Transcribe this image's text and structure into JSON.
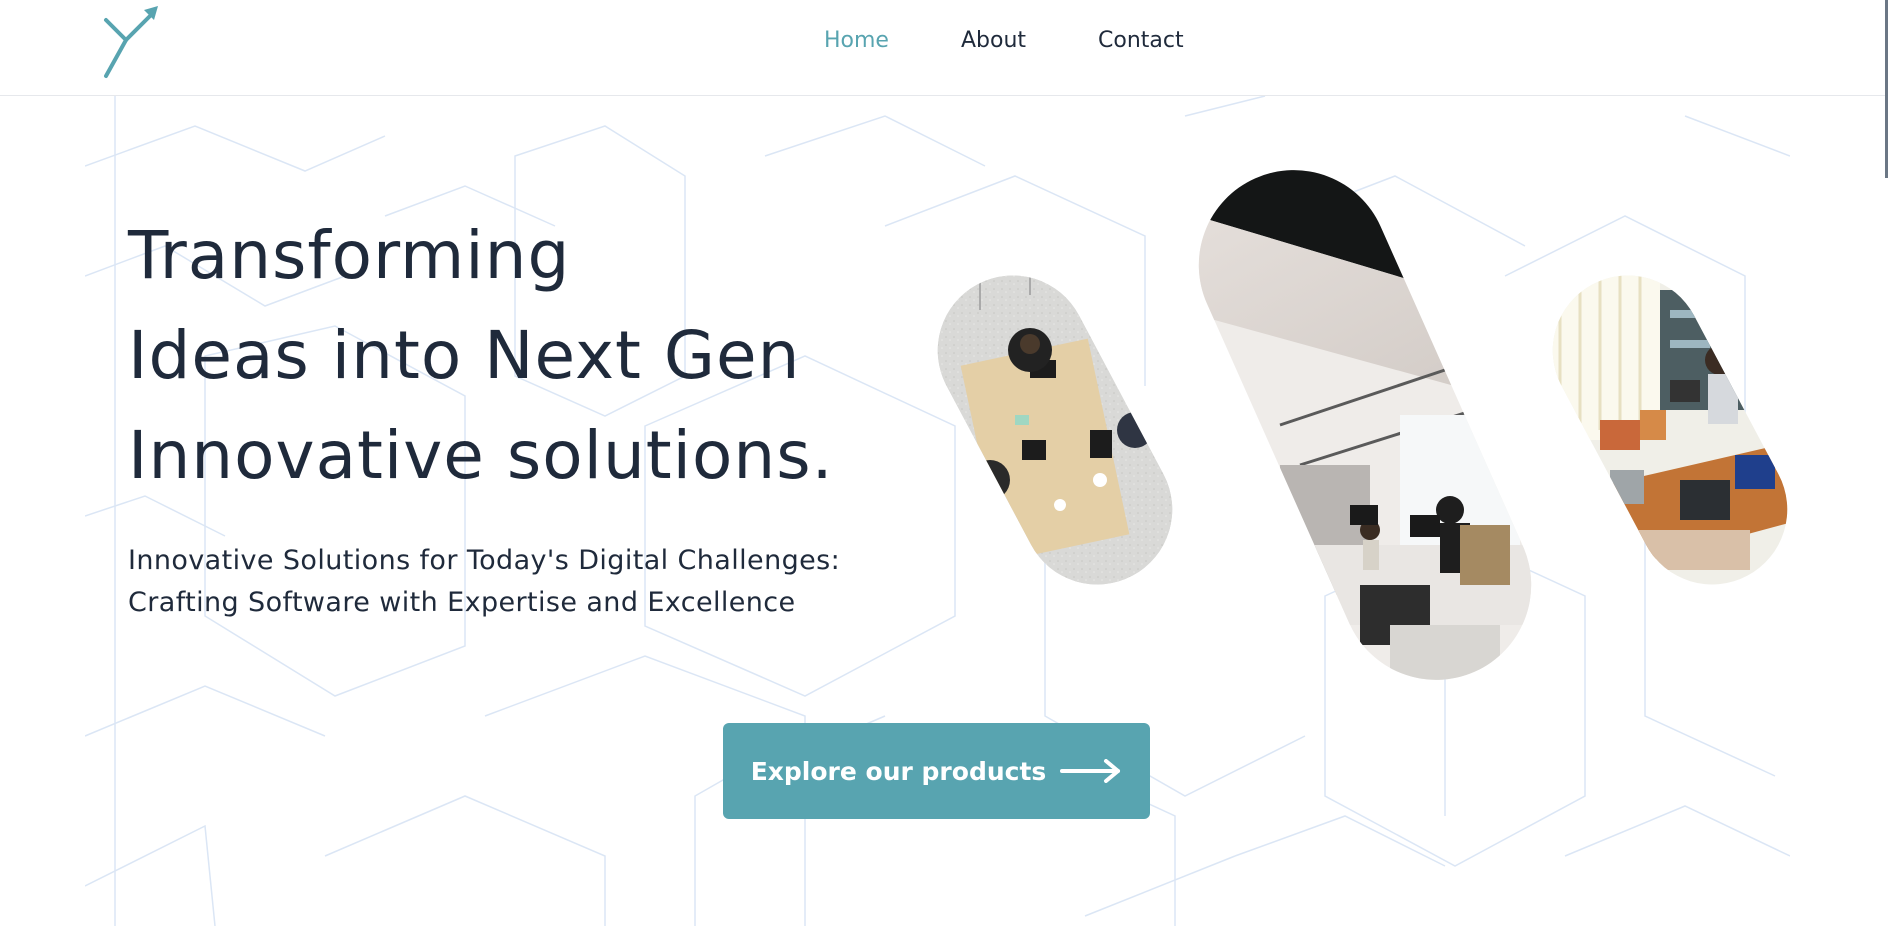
{
  "header": {
    "nav": [
      {
        "label": "Home",
        "active": true
      },
      {
        "label": "About",
        "active": false
      },
      {
        "label": "Contact",
        "active": false
      }
    ]
  },
  "hero": {
    "title_lines": [
      "Transforming",
      "Ideas into Next Gen",
      "Innovative solutions."
    ],
    "subtitle_lines": [
      "Innovative Solutions for Today's Digital Challenges:",
      "Crafting Software with Expertise and Excellence"
    ],
    "cta_label": "Explore our products"
  },
  "icons": {
    "logo": "arrow-y-logo-icon",
    "cta": "arrow-right-icon"
  },
  "colors": {
    "accent": "#58a4b0",
    "text": "#1f2a3b",
    "pattern_line": "#dbe6f5",
    "background": "#ffffff"
  },
  "images": [
    {
      "name": "office-meeting-aerial-image"
    },
    {
      "name": "open-office-interior-image"
    },
    {
      "name": "laptop-workspace-image"
    }
  ]
}
